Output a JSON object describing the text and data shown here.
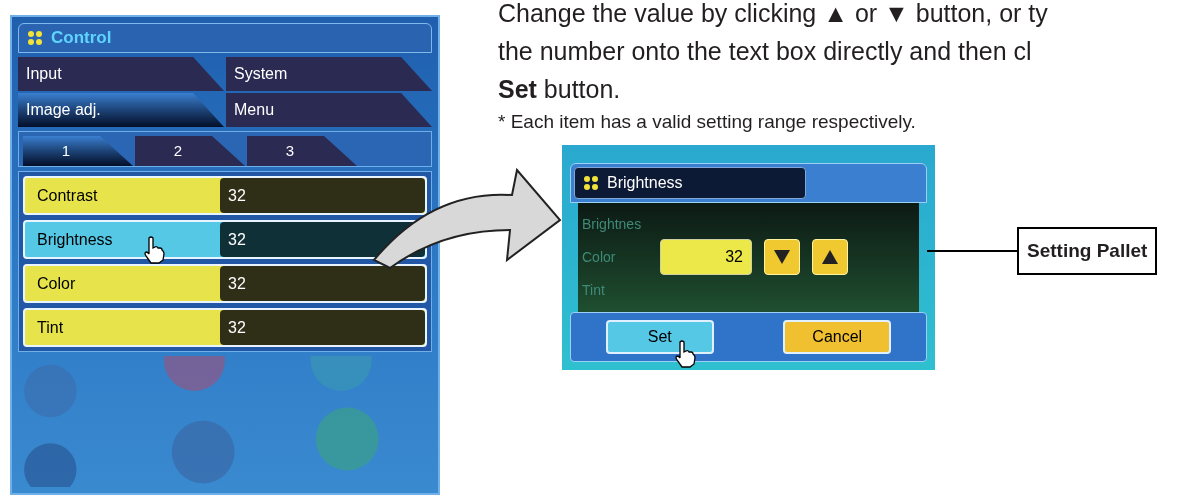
{
  "control_panel": {
    "title": "Control",
    "tabs": [
      {
        "label": "Input",
        "selected": false
      },
      {
        "label": "System",
        "selected": false
      },
      {
        "label": "Image adj.",
        "selected": true
      },
      {
        "label": "Menu",
        "selected": false
      }
    ],
    "subtabs": [
      {
        "label": "1",
        "selected": true
      },
      {
        "label": "2",
        "selected": false
      },
      {
        "label": "3",
        "selected": false
      }
    ],
    "rows": [
      {
        "label": "Contrast",
        "value": "32",
        "selected": false
      },
      {
        "label": "Brightness",
        "value": "32",
        "selected": true
      },
      {
        "label": "Color",
        "value": "32",
        "selected": false
      },
      {
        "label": "Tint",
        "value": "32",
        "selected": false
      }
    ]
  },
  "instruction": {
    "lines": [
      "Change the value by clicking ▲ or ▼ button, or ty",
      "the number onto the text box directly and then cl",
      "**Set** button."
    ],
    "note": "* Each item has a valid setting range respectively."
  },
  "pallet": {
    "title": "Brightness",
    "background_labels": [
      "Brightnes",
      "Color",
      "Tint"
    ],
    "value": "32",
    "buttons": [
      {
        "label": "Set",
        "kind": "primary"
      },
      {
        "label": "Cancel",
        "kind": "secondary"
      }
    ]
  },
  "callout": {
    "label": "Setting Pallet"
  }
}
